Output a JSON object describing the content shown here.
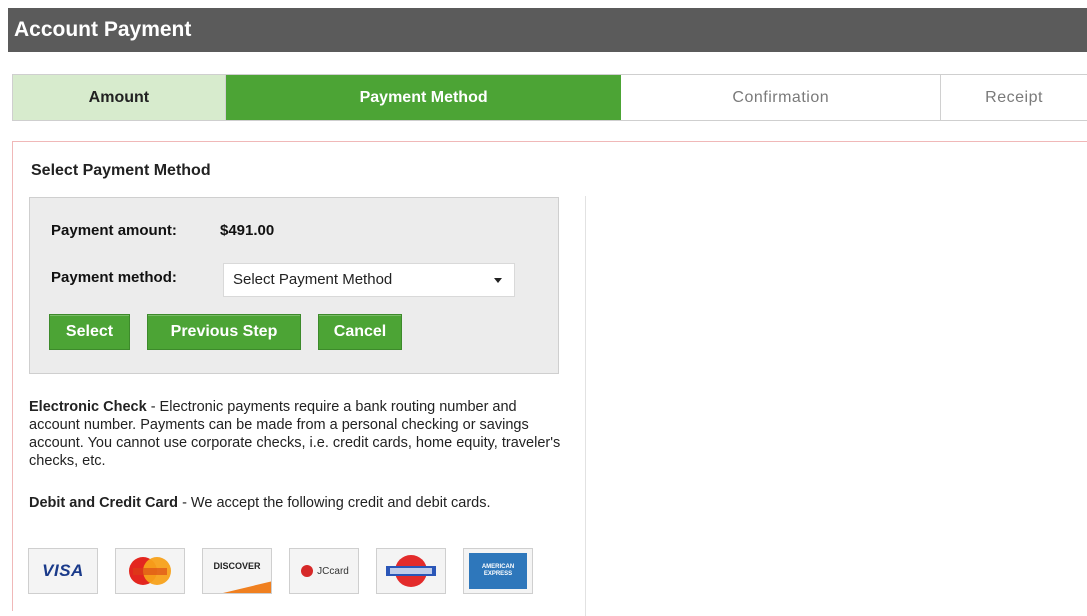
{
  "header": {
    "title": "Account Payment"
  },
  "steps": [
    {
      "label": "Amount"
    },
    {
      "label": "Payment Method"
    },
    {
      "label": "Confirmation"
    },
    {
      "label": "Receipt"
    }
  ],
  "section": {
    "title": "Select Payment Method"
  },
  "form": {
    "amount_label": "Payment amount:",
    "amount_value": "$491.00",
    "method_label": "Payment method:",
    "method_selected": "Select Payment Method",
    "buttons": {
      "select": "Select",
      "previous": "Previous Step",
      "cancel": "Cancel"
    }
  },
  "info": {
    "check_title": "Electronic Check",
    "check_text": " - Electronic payments require a bank routing number and account number. Payments can be made from a personal checking or savings account. You cannot use corporate checks, i.e. credit cards, home equity, traveler's checks, etc.",
    "card_title": "Debit and Credit Card",
    "card_text": " - We accept the following credit and debit cards."
  },
  "cards": [
    {
      "name": "VISA",
      "icon": "visa-logo"
    },
    {
      "name": "MasterCard",
      "icon": "mastercard-logo"
    },
    {
      "name": "DISCOVER",
      "icon": "discover-logo"
    },
    {
      "name": "JCcard",
      "icon": "jcb-logo"
    },
    {
      "name": "DinersClub",
      "icon": "diners-logo"
    },
    {
      "name": "AMERICAN EXPRESS",
      "icon": "amex-logo"
    }
  ],
  "colors": {
    "header_bg": "#5b5b5b",
    "accent_green": "#4ca435",
    "done_step": "#d7ebcd"
  }
}
